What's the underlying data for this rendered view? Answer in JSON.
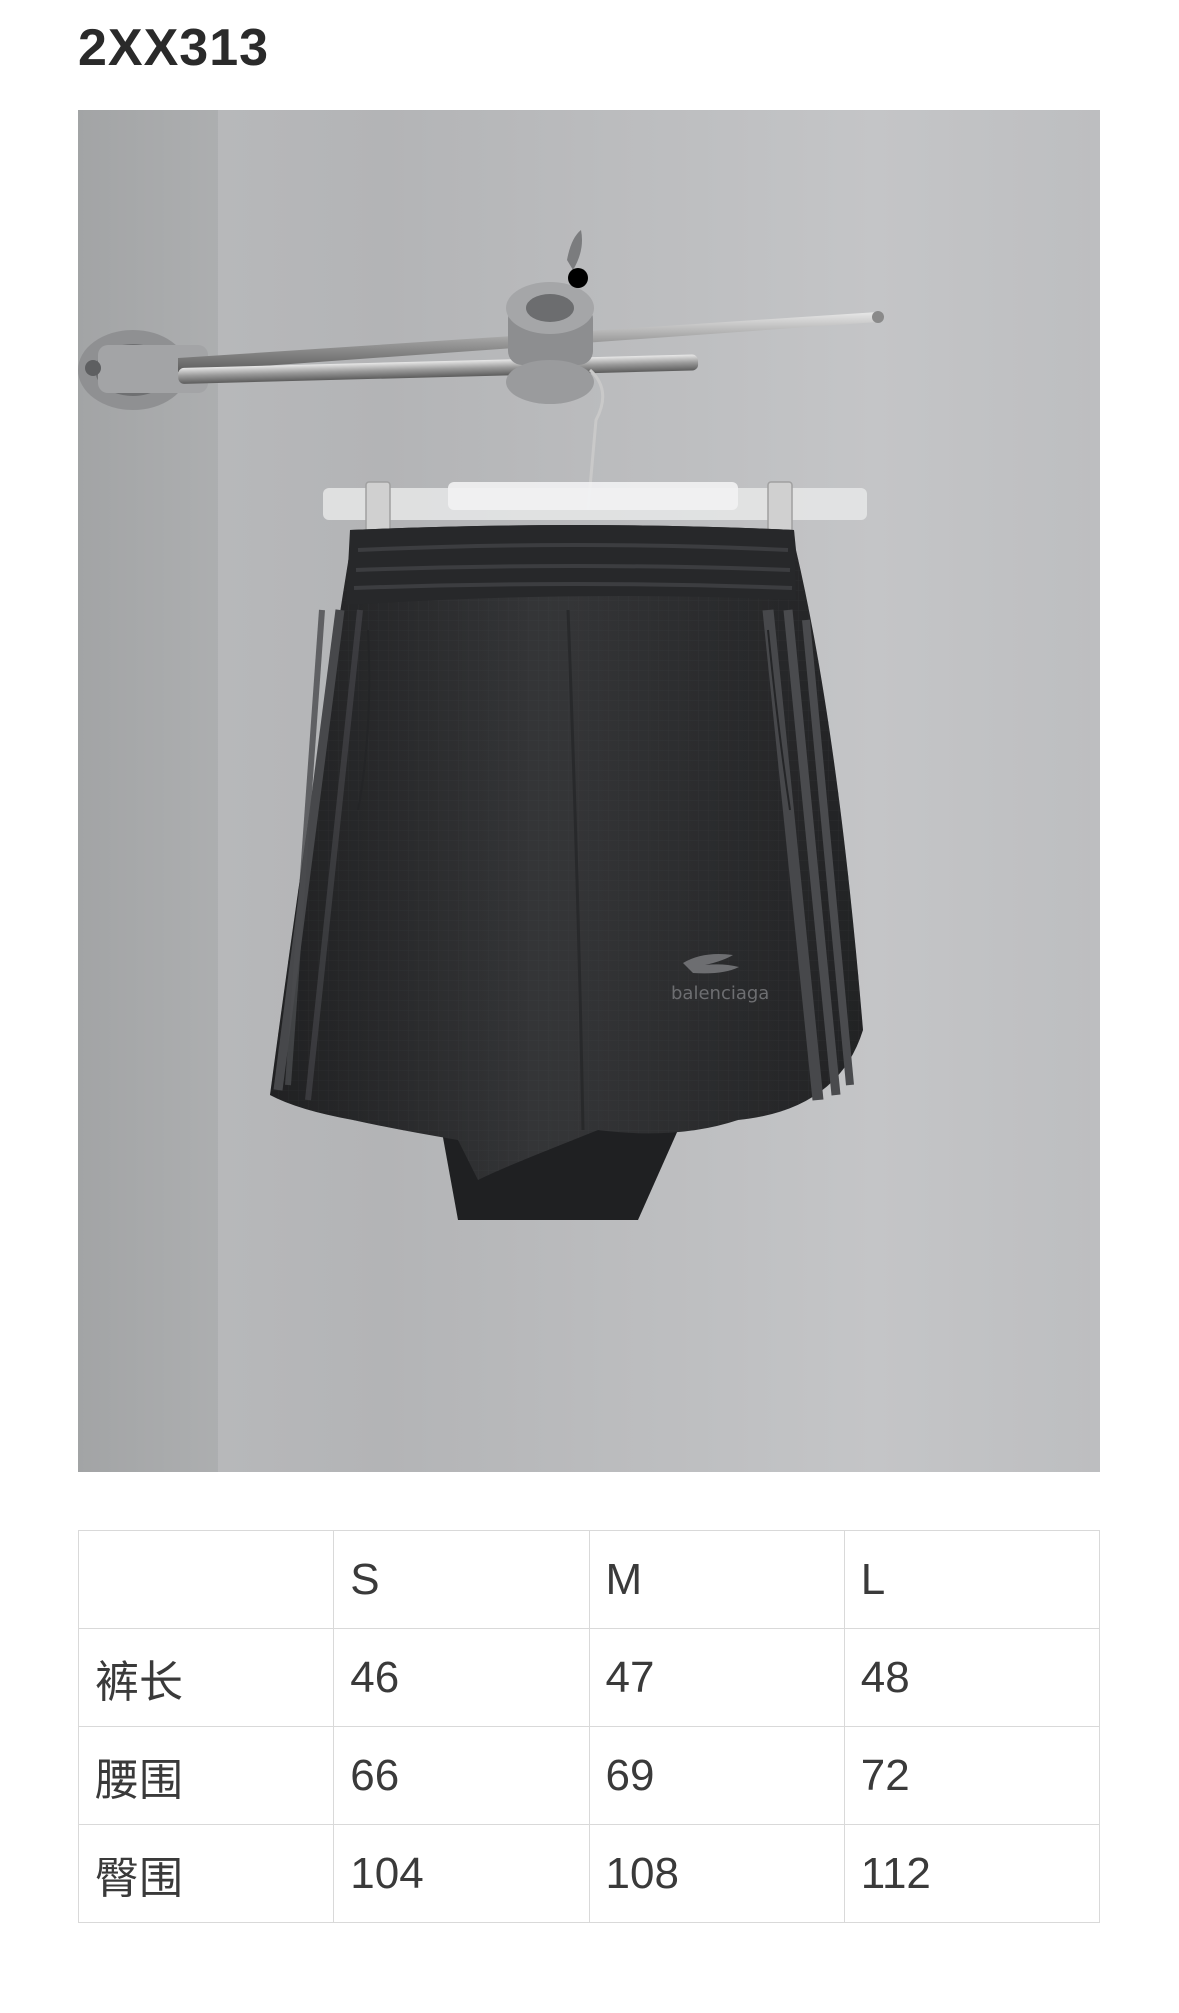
{
  "product": {
    "code": "2XX313"
  },
  "photo": {
    "subject": "black-shorts-on-hanger",
    "brand_print": "balenciaga"
  },
  "size_table": {
    "columns": [
      "",
      "S",
      "M",
      "L"
    ],
    "rows": [
      {
        "label": "裤长",
        "values": [
          "46",
          "47",
          "48"
        ]
      },
      {
        "label": "腰围",
        "values": [
          "66",
          "69",
          "72"
        ]
      },
      {
        "label": "臀围",
        "values": [
          "104",
          "108",
          "112"
        ]
      }
    ]
  }
}
